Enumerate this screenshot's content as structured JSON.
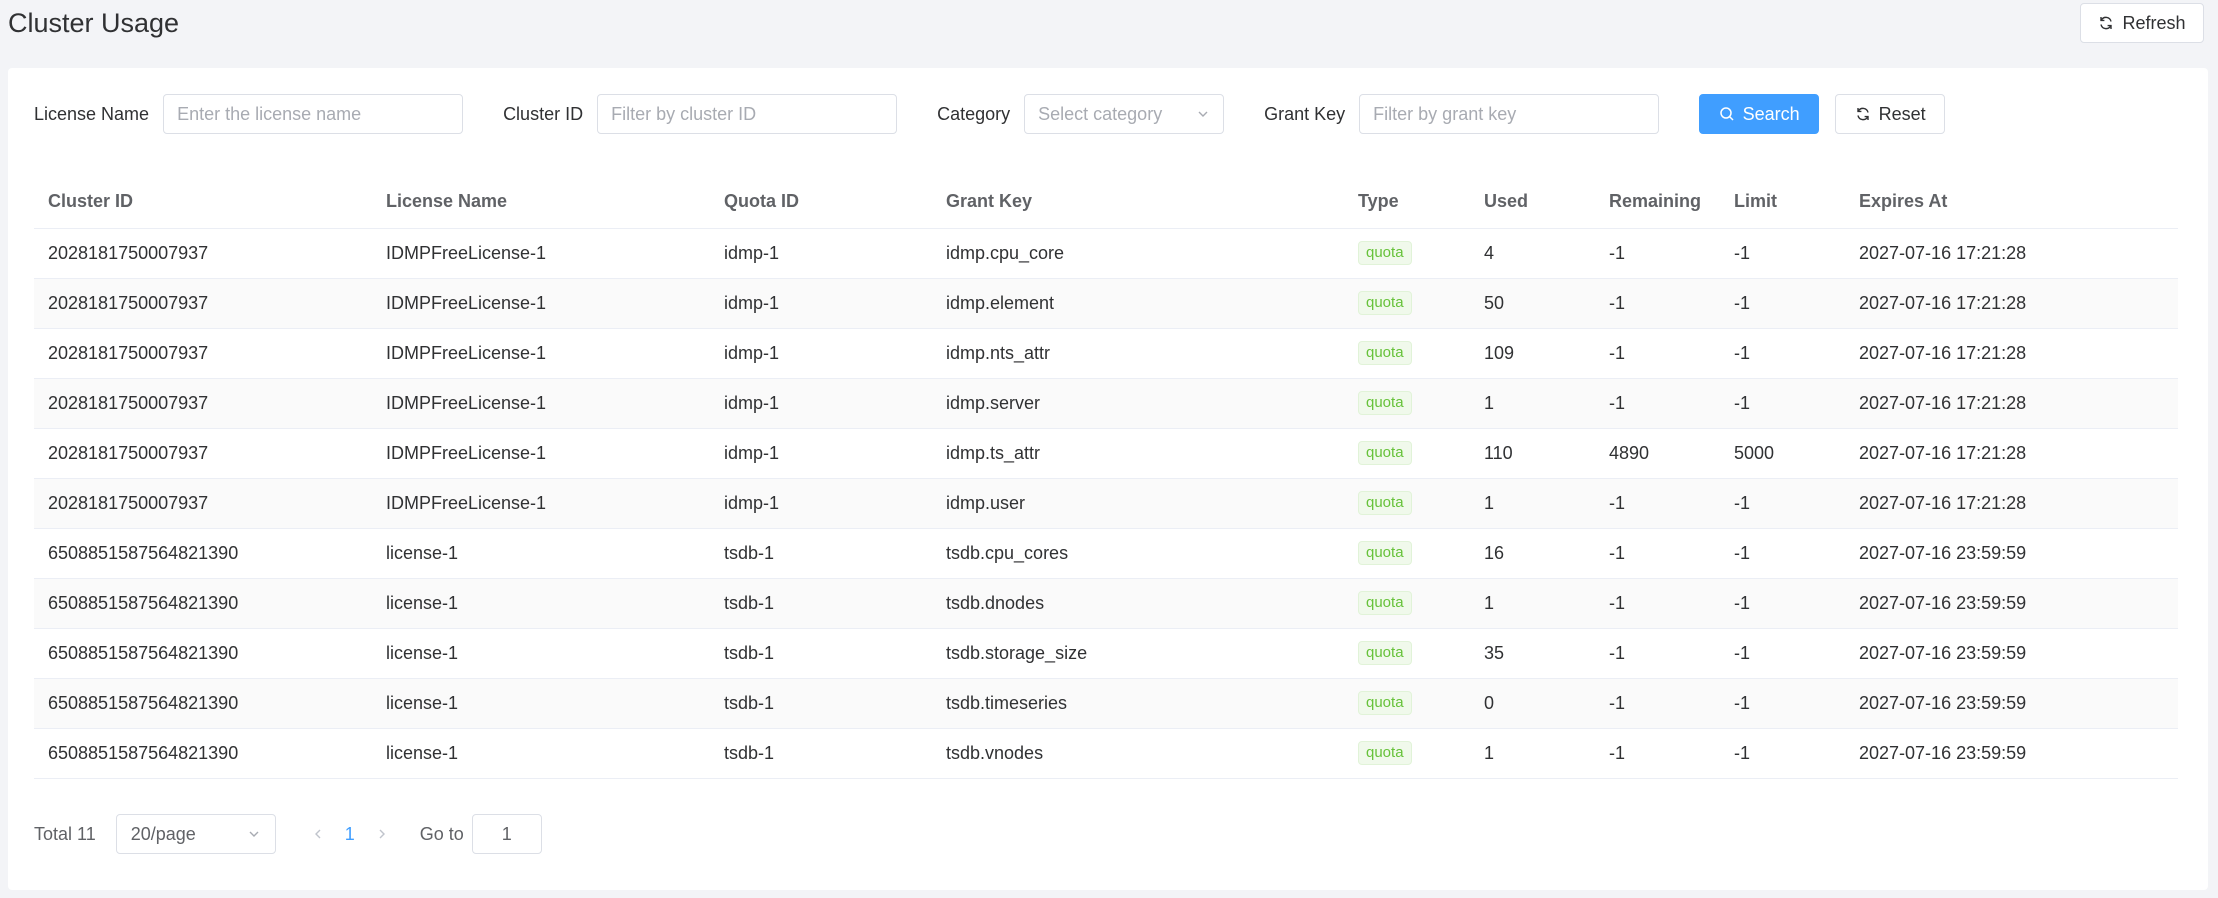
{
  "page": {
    "title": "Cluster Usage",
    "refresh_label": "Refresh"
  },
  "filters": {
    "license_name": {
      "label": "License Name",
      "placeholder": "Enter the license name"
    },
    "cluster_id": {
      "label": "Cluster ID",
      "placeholder": "Filter by cluster ID"
    },
    "category": {
      "label": "Category",
      "placeholder": "Select category"
    },
    "grant_key": {
      "label": "Grant Key",
      "placeholder": "Filter by grant key"
    },
    "search_label": "Search",
    "reset_label": "Reset"
  },
  "table": {
    "columns": [
      "Cluster ID",
      "License Name",
      "Quota ID",
      "Grant Key",
      "Type",
      "Used",
      "Remaining",
      "Limit",
      "Expires At"
    ],
    "rows": [
      [
        "2028181750007937",
        "IDMPFreeLicense-1",
        "idmp-1",
        "idmp.cpu_core",
        "quota",
        "4",
        "-1",
        "-1",
        "2027-07-16 17:21:28"
      ],
      [
        "2028181750007937",
        "IDMPFreeLicense-1",
        "idmp-1",
        "idmp.element",
        "quota",
        "50",
        "-1",
        "-1",
        "2027-07-16 17:21:28"
      ],
      [
        "2028181750007937",
        "IDMPFreeLicense-1",
        "idmp-1",
        "idmp.nts_attr",
        "quota",
        "109",
        "-1",
        "-1",
        "2027-07-16 17:21:28"
      ],
      [
        "2028181750007937",
        "IDMPFreeLicense-1",
        "idmp-1",
        "idmp.server",
        "quota",
        "1",
        "-1",
        "-1",
        "2027-07-16 17:21:28"
      ],
      [
        "2028181750007937",
        "IDMPFreeLicense-1",
        "idmp-1",
        "idmp.ts_attr",
        "quota",
        "110",
        "4890",
        "5000",
        "2027-07-16 17:21:28"
      ],
      [
        "2028181750007937",
        "IDMPFreeLicense-1",
        "idmp-1",
        "idmp.user",
        "quota",
        "1",
        "-1",
        "-1",
        "2027-07-16 17:21:28"
      ],
      [
        "6508851587564821390",
        "license-1",
        "tsdb-1",
        "tsdb.cpu_cores",
        "quota",
        "16",
        "-1",
        "-1",
        "2027-07-16 23:59:59"
      ],
      [
        "6508851587564821390",
        "license-1",
        "tsdb-1",
        "tsdb.dnodes",
        "quota",
        "1",
        "-1",
        "-1",
        "2027-07-16 23:59:59"
      ],
      [
        "6508851587564821390",
        "license-1",
        "tsdb-1",
        "tsdb.storage_size",
        "quota",
        "35",
        "-1",
        "-1",
        "2027-07-16 23:59:59"
      ],
      [
        "6508851587564821390",
        "license-1",
        "tsdb-1",
        "tsdb.timeseries",
        "quota",
        "0",
        "-1",
        "-1",
        "2027-07-16 23:59:59"
      ],
      [
        "6508851587564821390",
        "license-1",
        "tsdb-1",
        "tsdb.vnodes",
        "quota",
        "1",
        "-1",
        "-1",
        "2027-07-16 23:59:59"
      ]
    ]
  },
  "pagination": {
    "total_label": "Total 11",
    "page_size": "20/page",
    "current_page": "1",
    "goto_label": "Go to",
    "goto_value": "1"
  },
  "colors": {
    "primary": "#409eff",
    "tag_green": "#67c23a"
  },
  "icons": {
    "refresh": "refresh-icon",
    "search": "search-icon",
    "chevron": "chevron-down-icon"
  }
}
